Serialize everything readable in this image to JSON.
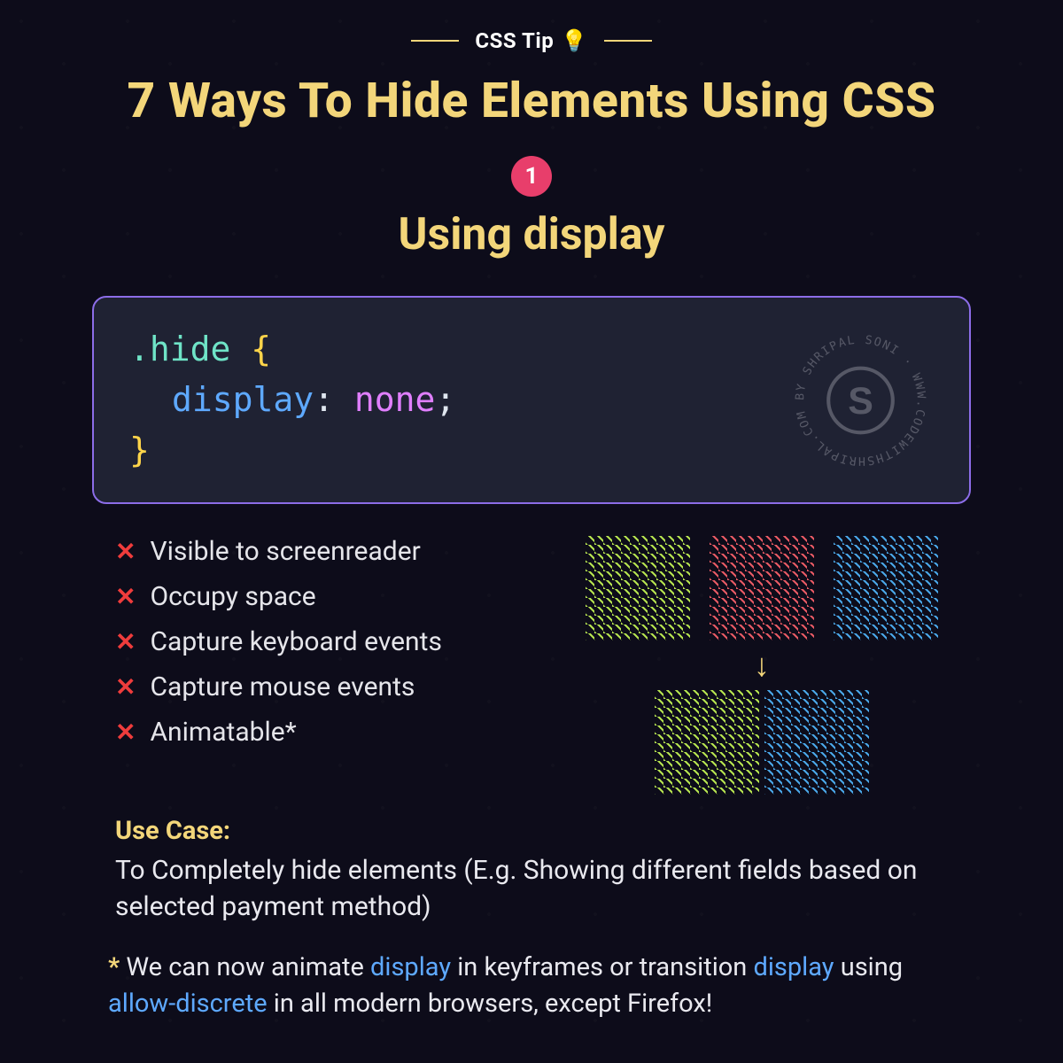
{
  "kicker": "CSS Tip",
  "title": "7 Ways To Hide Elements Using CSS",
  "step_number": "1",
  "subtitle": "Using display",
  "code": {
    "selector": ".hide",
    "property": "display",
    "value": "none"
  },
  "watermark": {
    "circular_text": "BY SHRIPAL SONI · WWW.CODEWITHSHRIPAL.COM · ",
    "glyph": "S"
  },
  "features": [
    {
      "status": "x",
      "label": "Visible to screenreader"
    },
    {
      "status": "x",
      "label": "Occupy space"
    },
    {
      "status": "x",
      "label": "Capture keyboard events"
    },
    {
      "status": "x",
      "label": "Capture mouse events"
    },
    {
      "status": "x",
      "label": "Animatable*"
    }
  ],
  "usecase": {
    "label": "Use Case:",
    "text": "To Completely hide elements (E.g. Showing different fields based on selected payment method)"
  },
  "footnote": {
    "star": "*",
    "pre": "We can now animate ",
    "kw1": "display",
    "mid": " in keyframes or transition ",
    "kw2": "display",
    "mid2": " using ",
    "kw3": "allow-discrete",
    "post": " in all modern browsers, except Firefox!"
  },
  "demo": {
    "before": [
      "green",
      "red",
      "blue"
    ],
    "after": [
      "green",
      "blue"
    ]
  }
}
